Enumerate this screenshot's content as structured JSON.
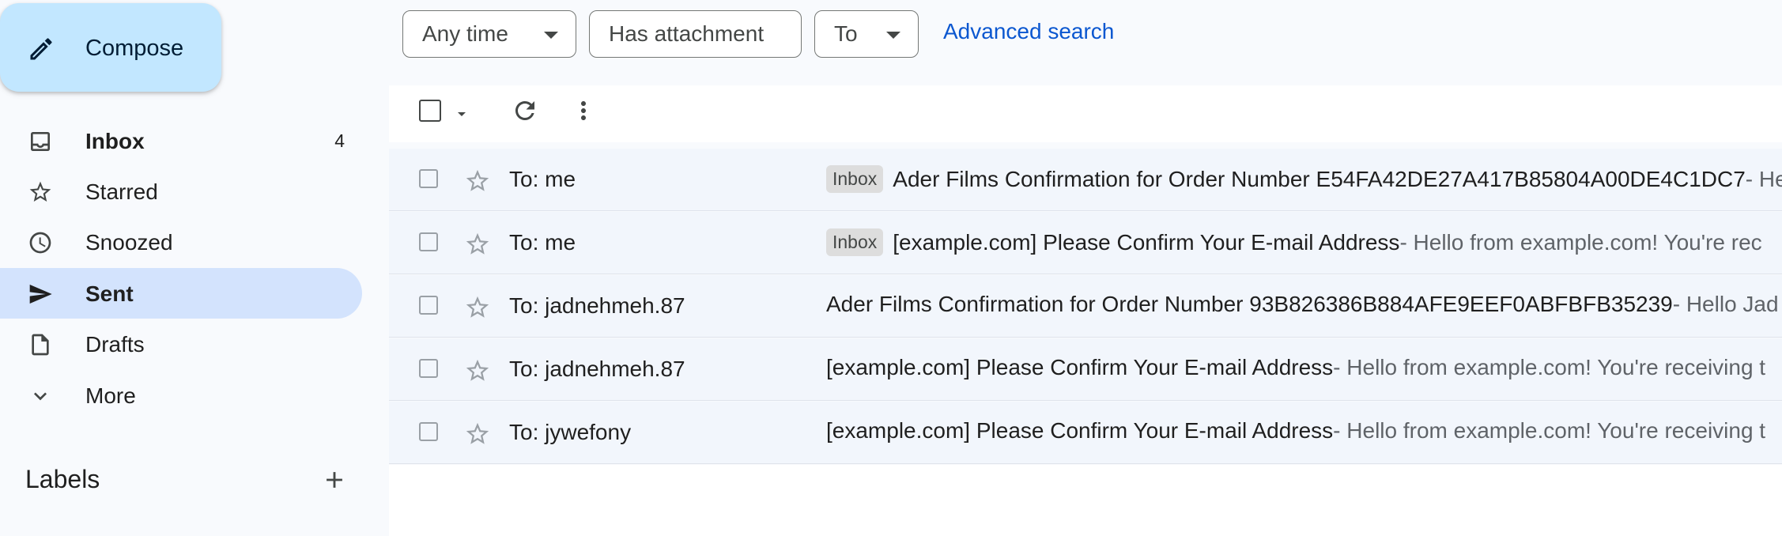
{
  "compose": {
    "label": "Compose"
  },
  "nav": [
    {
      "label": "Inbox",
      "count": "4"
    },
    {
      "label": "Starred"
    },
    {
      "label": "Snoozed"
    },
    {
      "label": "Sent"
    },
    {
      "label": "Drafts"
    },
    {
      "label": "More"
    }
  ],
  "labels": {
    "title": "Labels"
  },
  "filters": {
    "any_time": "Any time",
    "has_attachment": "Has attachment",
    "to": "To",
    "advanced_search": "Advanced search"
  },
  "emails": [
    {
      "sender": "To: me",
      "badge": "Inbox",
      "subject": "Ader Films Confirmation for Order Number E54FA42DE27A417B85804A00DE4C1DC7",
      "snippet": " - He"
    },
    {
      "sender": "To: me",
      "badge": "Inbox",
      "subject": "[example.com] Please Confirm Your E-mail Address",
      "snippet": " - Hello from example.com! You're rec"
    },
    {
      "sender": "To: jadnehmeh.87",
      "badge": "",
      "subject": "Ader Films Confirmation for Order Number 93B826386B884AFE9EEF0ABFBFB35239",
      "snippet": " - Hello Jad"
    },
    {
      "sender": "To: jadnehmeh.87",
      "badge": "",
      "subject": "[example.com] Please Confirm Your E-mail Address",
      "snippet": " - Hello from example.com! You're receiving t"
    },
    {
      "sender": "To: jywefony",
      "badge": "",
      "subject": "[example.com] Please Confirm Your E-mail Address",
      "snippet": " - Hello from example.com! You're receiving t"
    }
  ]
}
